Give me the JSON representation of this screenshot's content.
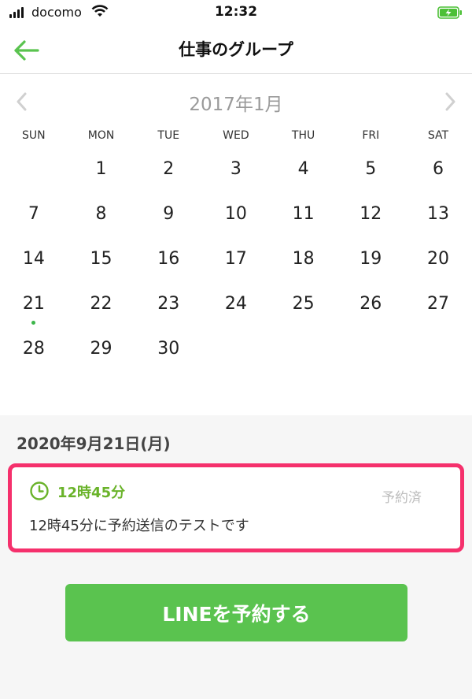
{
  "status_bar": {
    "carrier": "docomo",
    "time": "12:32"
  },
  "nav": {
    "title": "仕事のグループ",
    "back_icon": "arrow-left-icon"
  },
  "calendar": {
    "month_title": "2017年1月",
    "weekdays": [
      "SUN",
      "MON",
      "TUE",
      "WED",
      "THU",
      "FRI",
      "SAT"
    ],
    "leading_blanks": 1,
    "days": [
      "1",
      "2",
      "3",
      "4",
      "5",
      "6",
      "7",
      "8",
      "9",
      "10",
      "11",
      "12",
      "13",
      "14",
      "15",
      "16",
      "17",
      "18",
      "19",
      "20",
      "21",
      "22",
      "23",
      "24",
      "25",
      "26",
      "27",
      "28",
      "29",
      "30"
    ],
    "marked_day": "21"
  },
  "schedule": {
    "selected_date": "2020年9月21日(月)",
    "card": {
      "time": "12時45分",
      "status": "予約済",
      "message": "12時45分に予約送信のテストです"
    },
    "button_label": "LINEを予約する"
  },
  "colors": {
    "accent_green": "#5ac34f",
    "time_green": "#6ab32a",
    "highlight_pink": "#f5306c"
  }
}
